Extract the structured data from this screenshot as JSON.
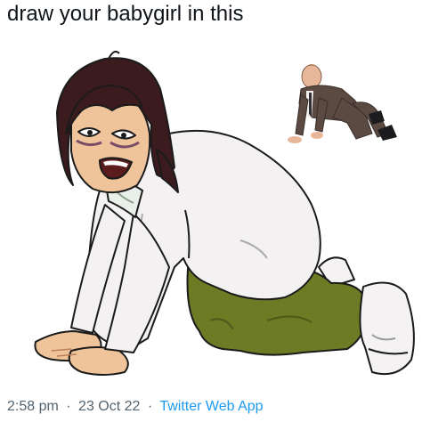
{
  "tweet": {
    "text": "draw your babygirl in this",
    "time": "2:58 pm",
    "separator1": "·",
    "date": "23 Oct 22",
    "separator2": "·",
    "source": "Twitter Web App"
  },
  "media": {
    "main_drawing": "cartoon-character-crawling-on-all-fours",
    "reference_photo": "man-in-suit-crawling-reference-photo"
  },
  "colors": {
    "text": "#0f1419",
    "meta": "#536471",
    "link": "#1d9bf0",
    "coat": "#f4f1f2",
    "pants": "#6d7b24",
    "hair": "#3b1b1d",
    "skin": "#f0c49b"
  }
}
